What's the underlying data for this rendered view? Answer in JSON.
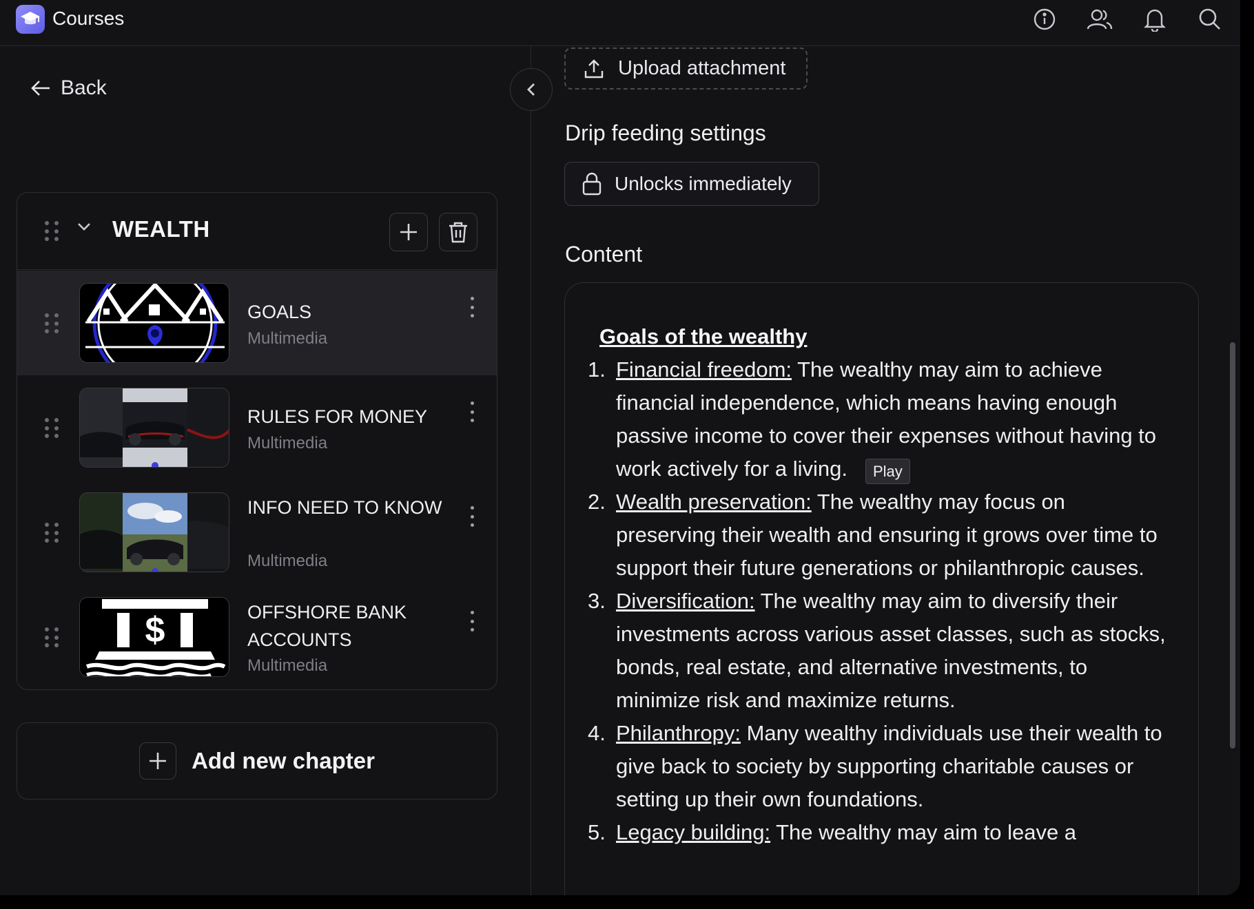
{
  "topbar": {
    "app_title": "Courses",
    "app_icon": "graduation-cap-icon",
    "icons": [
      "info-icon",
      "users-icon",
      "bell-icon",
      "search-icon"
    ]
  },
  "sidebar": {
    "back_label": "Back",
    "chapter": {
      "title": "WEALTH",
      "lessons": [
        {
          "name": "GOALS",
          "type": "Multimedia",
          "active": true
        },
        {
          "name": "RULES FOR MONEY",
          "type": "Multimedia",
          "active": false
        },
        {
          "name": "INFO NEED TO KNOW",
          "type": "Multimedia",
          "active": false
        },
        {
          "name": "OFFSHORE BANK ACCOUNTS",
          "type": "Multimedia",
          "active": false
        }
      ]
    },
    "add_chapter_label": "Add new chapter"
  },
  "main": {
    "upload_label": "Upload attachment",
    "drip_heading": "Drip feeding settings",
    "unlock_label": "Unlocks immediately",
    "content_heading": "Content",
    "doc": {
      "title": "Goals of the wealthy",
      "items": [
        {
          "num": "1.",
          "term": "Financial freedom:",
          "text": " The wealthy may aim to achieve financial independence, which means having enough passive income to cover their expenses without having to work actively for a living."
        },
        {
          "num": "2.",
          "term": "Wealth preservation:",
          "text": " The wealthy may focus on preserving their wealth and ensuring it grows over time to support their future generations or philanthropic causes."
        },
        {
          "num": "3.",
          "term": "Diversification:",
          "text": " The wealthy may aim to diversify their investments across various asset classes, such as stocks, bonds, real estate, and alternative investments, to minimize risk and maximize returns."
        },
        {
          "num": "4.",
          "term": "Philanthropy:",
          "text": " Many wealthy individuals use their wealth to give back to society by supporting charitable causes or setting up their own foundations."
        },
        {
          "num": "5.",
          "term": "Legacy building:",
          "text": " The wealthy may aim to leave a"
        }
      ]
    }
  },
  "tooltip": {
    "label": "Play"
  },
  "colors": {
    "background": "#131316",
    "border": "#2f2f33",
    "accent": "#6c6af0",
    "muted_text": "#7e7e86"
  }
}
